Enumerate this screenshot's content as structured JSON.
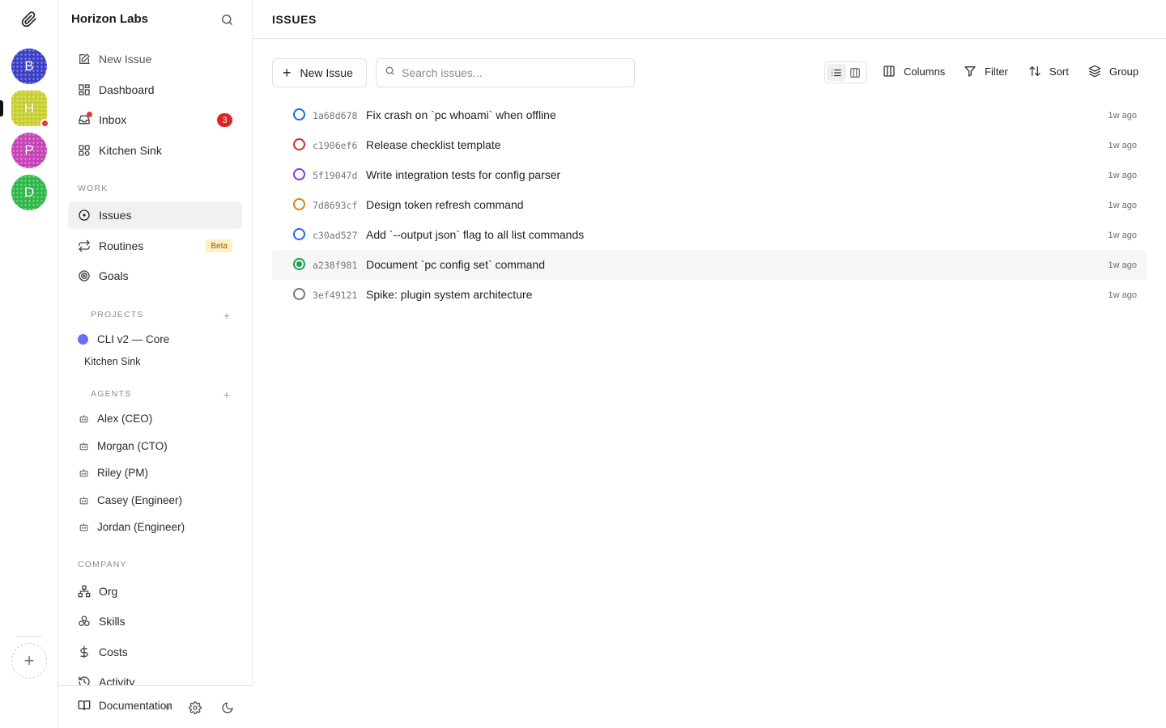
{
  "rail": {
    "workspaces": [
      {
        "letter": "B",
        "color": "#3a3fc7"
      },
      {
        "letter": "H",
        "color": "#c9cf2e"
      },
      {
        "letter": "P",
        "color": "#c642b8"
      },
      {
        "letter": "D",
        "color": "#2fb84a"
      }
    ],
    "add_label": "+"
  },
  "sidebar": {
    "company_name": "Horizon Labs",
    "top_items": [
      {
        "label": "New Issue",
        "icon": "edit-icon"
      },
      {
        "label": "Dashboard",
        "icon": "dashboard-icon"
      },
      {
        "label": "Inbox",
        "icon": "inbox-icon",
        "badge": "3"
      },
      {
        "label": "Kitchen Sink",
        "icon": "grid-icon"
      }
    ],
    "work_section": "WORK",
    "work_items": [
      {
        "label": "Issues",
        "icon": "circle-dot-icon",
        "active": true
      },
      {
        "label": "Routines",
        "icon": "repeat-icon",
        "badge": "Beta"
      },
      {
        "label": "Goals",
        "icon": "target-icon"
      }
    ],
    "projects_section": "PROJECTS",
    "projects": [
      {
        "label": "CLI v2 — Core",
        "color": "#6b6ff0"
      }
    ],
    "project_sub": "Kitchen Sink",
    "agents_section": "AGENTS",
    "agents": [
      "Alex (CEO)",
      "Morgan (CTO)",
      "Riley (PM)",
      "Casey (Engineer)",
      "Jordan (Engineer)"
    ],
    "company_section": "COMPANY",
    "company_items": [
      {
        "label": "Org",
        "icon": "org-icon"
      },
      {
        "label": "Skills",
        "icon": "skills-icon"
      },
      {
        "label": "Costs",
        "icon": "dollar-icon"
      },
      {
        "label": "Activity",
        "icon": "history-icon"
      }
    ],
    "footer": {
      "docs_label": "Documentation",
      "version": "v"
    }
  },
  "main": {
    "title": "ISSUES",
    "new_issue_label": "New Issue",
    "search_placeholder": "Search issues...",
    "toolbar": {
      "columns": "Columns",
      "filter": "Filter",
      "sort": "Sort",
      "group": "Group"
    },
    "issues": [
      {
        "id": "1a68d678",
        "title": "Fix crash on `pc whoami` when offline",
        "age": "1w ago",
        "status_color": "#2563eb",
        "done": false
      },
      {
        "id": "c1906ef6",
        "title": "Release checklist template",
        "age": "1w ago",
        "status_color": "#dc2626",
        "done": false
      },
      {
        "id": "5f19047d",
        "title": "Write integration tests for config parser",
        "age": "1w ago",
        "status_color": "#7c3aed",
        "done": false
      },
      {
        "id": "7d8693cf",
        "title": "Design token refresh command",
        "age": "1w ago",
        "status_color": "#ca8a04",
        "done": false
      },
      {
        "id": "c30ad527",
        "title": "Add `--output json` flag to all list commands",
        "age": "1w ago",
        "status_color": "#2563eb",
        "done": false
      },
      {
        "id": "a238f981",
        "title": "Document `pc config set` command",
        "age": "1w ago",
        "status_color": "#16a34a",
        "done": true
      },
      {
        "id": "3ef49121",
        "title": "Spike: plugin system architecture",
        "age": "1w ago",
        "status_color": "#777777",
        "done": false
      }
    ]
  }
}
